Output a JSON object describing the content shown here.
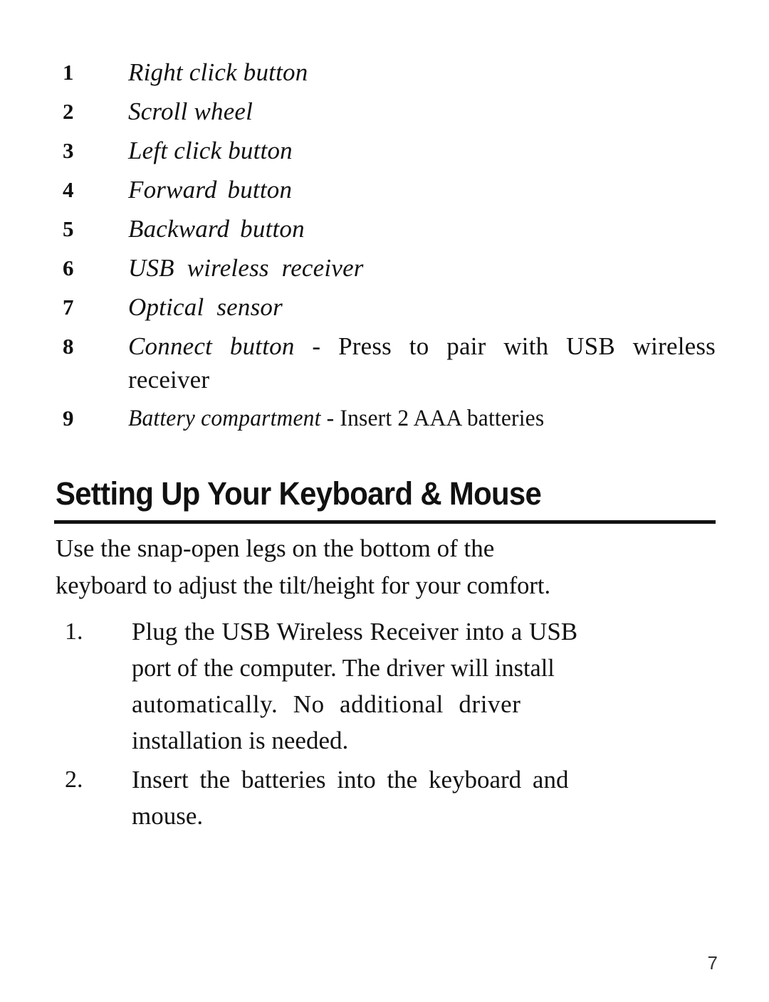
{
  "document": {
    "page_number": "7",
    "parts_list": [
      {
        "number": "1",
        "label": "Right click button"
      },
      {
        "number": "2",
        "label": "Scroll wheel"
      },
      {
        "number": "3",
        "label": "Left click button"
      },
      {
        "number": "4",
        "label": "Forward  button"
      },
      {
        "number": "5",
        "label": "Backward  button"
      },
      {
        "number": "6",
        "label": "USB wireless receiver"
      },
      {
        "number": "7",
        "label": "Optical  sensor"
      },
      {
        "number": "8",
        "term": "Connect button",
        "description": " - Press to pair with USB wireless receiver"
      },
      {
        "number": "9",
        "term": "Battery compartment",
        "description": " - Insert 2 AAA batteries"
      }
    ],
    "section": {
      "heading": "Setting Up Your Keyboard & Mouse",
      "intro_line_1": "Use the snap-open legs on the bottom of the",
      "intro_line_2": "keyboard to adjust the tilt/height for your comfort.",
      "steps": [
        {
          "number": "1.",
          "line_1": "Plug the USB Wireless Receiver into a USB",
          "line_2": "port of the computer.  The driver will install",
          "line_3": "automatically. No additional driver",
          "line_4": "installation is needed."
        },
        {
          "number": "2.",
          "line_1": "Insert the batteries into the keyboard and",
          "line_2": "mouse."
        }
      ]
    }
  }
}
